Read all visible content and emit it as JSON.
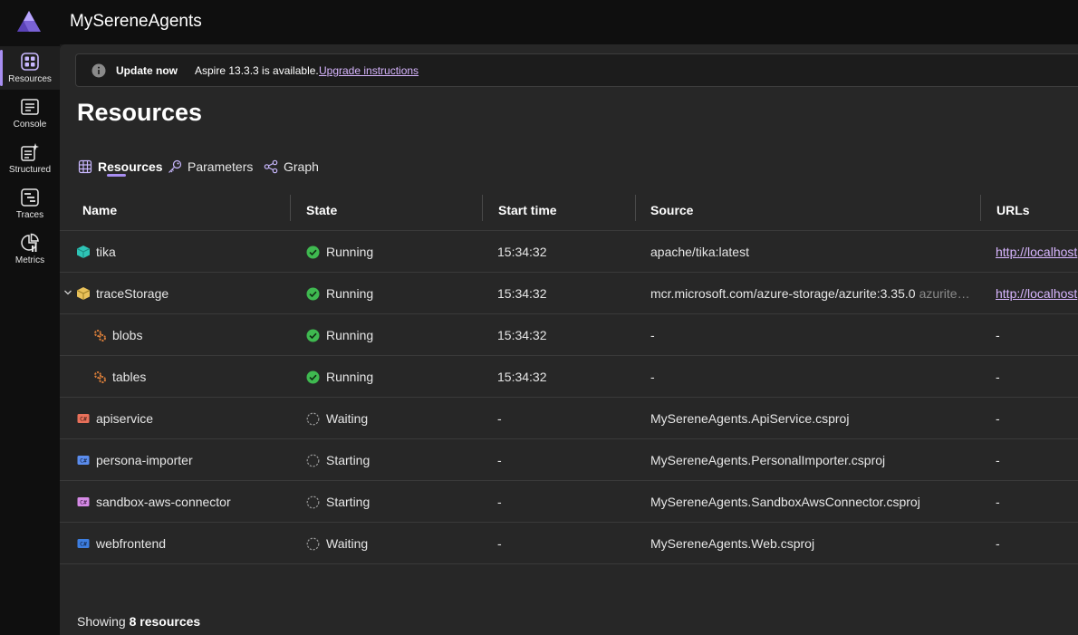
{
  "app": {
    "title": "MySereneAgents"
  },
  "sidebar": {
    "items": [
      {
        "label": "Resources",
        "icon": "resources-icon",
        "active": true
      },
      {
        "label": "Console",
        "icon": "console-icon",
        "active": false
      },
      {
        "label": "Structured",
        "icon": "structured-icon",
        "active": false
      },
      {
        "label": "Traces",
        "icon": "traces-icon",
        "active": false
      },
      {
        "label": "Metrics",
        "icon": "metrics-icon",
        "active": false
      }
    ]
  },
  "banner": {
    "strong": "Update now",
    "text": "Aspire 13.3.3 is available.",
    "link": "Upgrade instructions"
  },
  "page": {
    "title": "Resources"
  },
  "tabs": [
    {
      "label": "Resources",
      "icon": "grid-icon",
      "active": true
    },
    {
      "label": "Parameters",
      "icon": "key-icon",
      "active": false
    },
    {
      "label": "Graph",
      "icon": "share-graph-icon",
      "active": false
    }
  ],
  "table": {
    "columns": [
      "Name",
      "State",
      "Start time",
      "Source",
      "URLs"
    ],
    "rows": [
      {
        "name": "tika",
        "icon": "container-icon",
        "state": "Running",
        "start": "15:34:32",
        "source": "apache/tika:latest",
        "source_extra": "",
        "url": "http://localhost"
      },
      {
        "name": "traceStorage",
        "icon": "storage-icon",
        "state": "Running",
        "start": "15:34:32",
        "source": "mcr.microsoft.com/azure-storage/azurite:3.35.0",
        "source_extra": "azurite…",
        "url": "http://localhost"
      },
      {
        "name": "blobs",
        "icon": "gear-icon",
        "state": "Running",
        "start": "15:34:32",
        "source": "-",
        "source_extra": "",
        "url": "-"
      },
      {
        "name": "tables",
        "icon": "gear-icon",
        "state": "Running",
        "start": "15:34:32",
        "source": "-",
        "source_extra": "",
        "url": "-"
      },
      {
        "name": "apiservice",
        "icon": "csharp-project-icon",
        "state": "Waiting",
        "start": "-",
        "source": "MySereneAgents.ApiService.csproj",
        "source_extra": "",
        "url": "-"
      },
      {
        "name": "persona-importer",
        "icon": "csharp-project-icon",
        "state": "Starting",
        "start": "-",
        "source": "MySereneAgents.PersonalImporter.csproj",
        "source_extra": "",
        "url": "-"
      },
      {
        "name": "sandbox-aws-connector",
        "icon": "csharp-project-icon",
        "state": "Starting",
        "start": "-",
        "source": "MySereneAgents.SandboxAwsConnector.csproj",
        "source_extra": "",
        "url": "-"
      },
      {
        "name": "webfrontend",
        "icon": "csharp-project-icon",
        "state": "Waiting",
        "start": "-",
        "source": "MySereneAgents.Web.csproj",
        "source_extra": "",
        "url": "-"
      }
    ]
  },
  "footer": {
    "prefix": "Showing",
    "count": "8 resources"
  },
  "colors": {
    "accent": "#a88ef2",
    "link": "#d8b6ff",
    "running": "#3fb950",
    "container": "#2ec4b6",
    "storage": "#e8c15a",
    "gear": "#d97e3a",
    "cs_red": "#e8705a",
    "cs_blue": "#5b8dee",
    "cs_pink": "#d68ae6",
    "cs_darkblue": "#3d7ee0"
  }
}
